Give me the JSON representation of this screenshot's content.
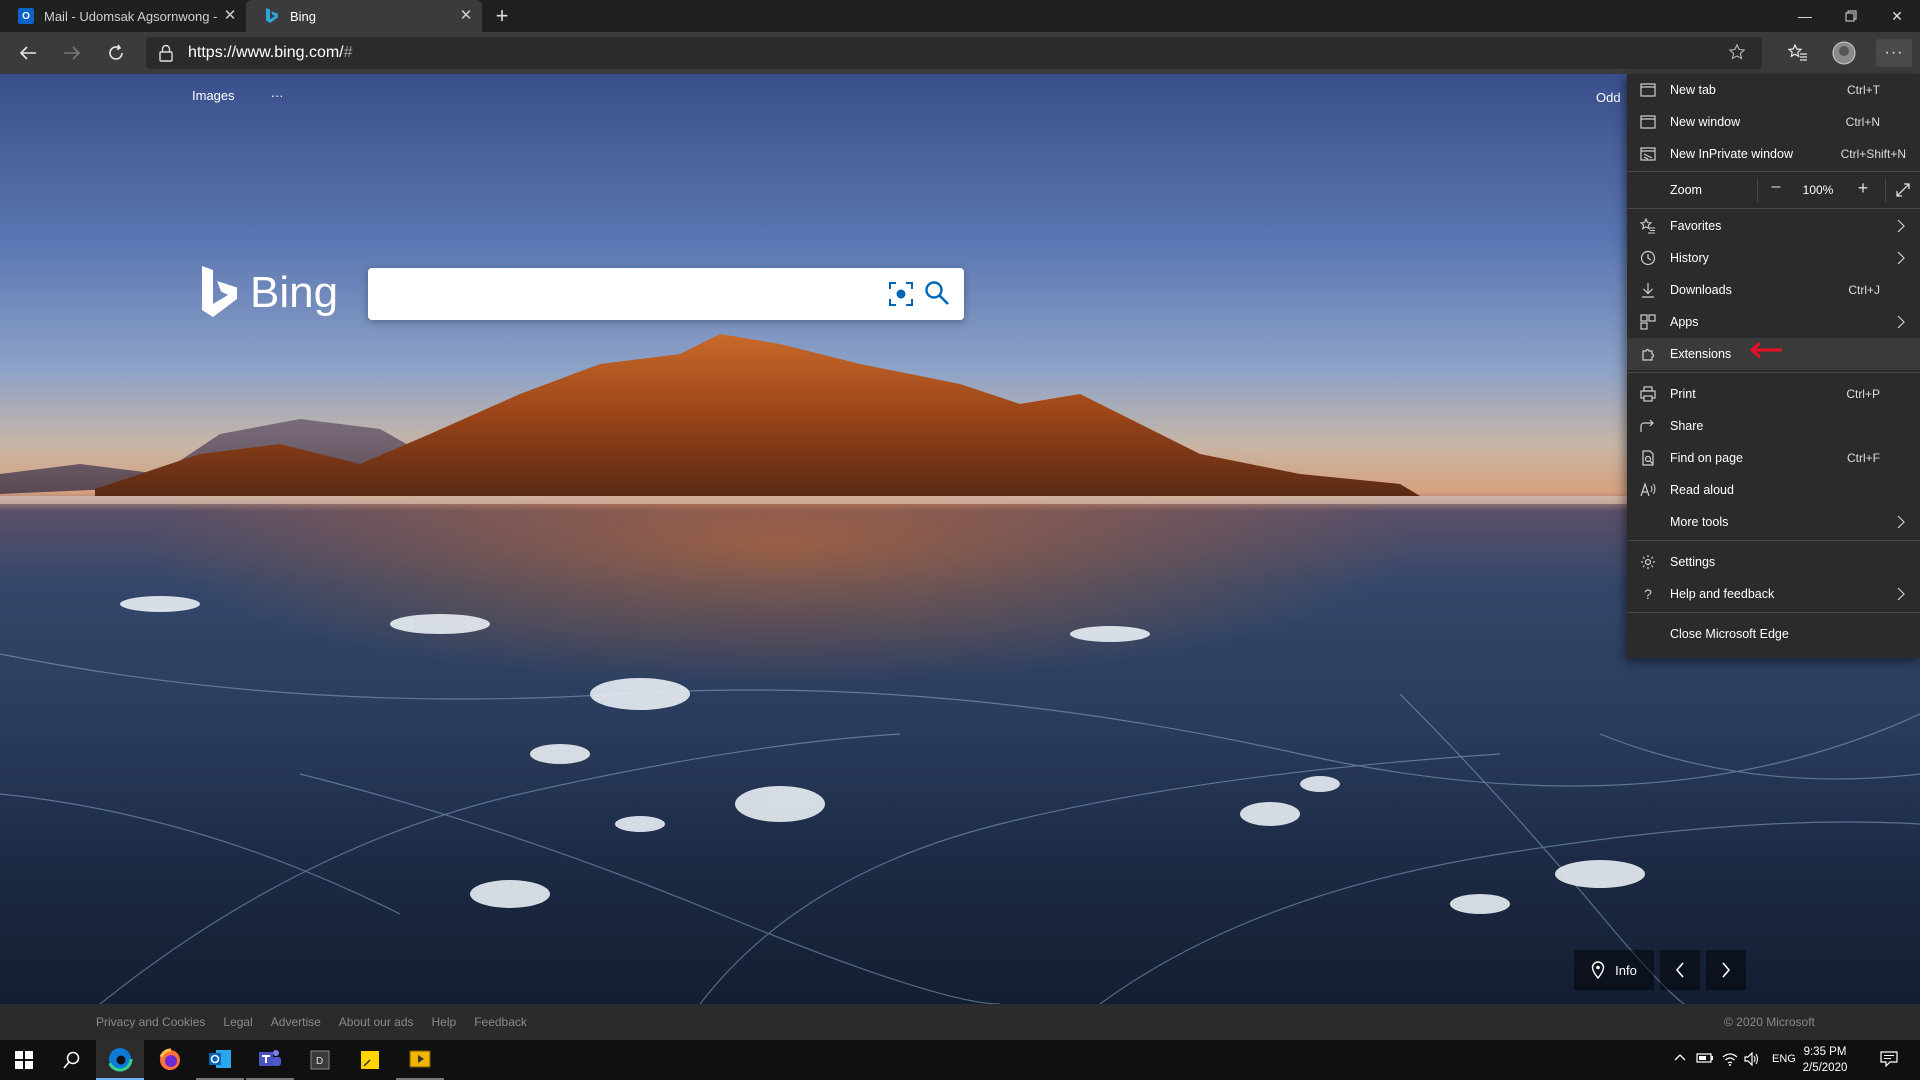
{
  "tabs": [
    {
      "title": "Mail - Udomsak Agsornwong - C",
      "icon": "outlook-icon",
      "active": false
    },
    {
      "title": "Bing",
      "icon": "bing-icon",
      "active": true
    }
  ],
  "toolbar": {
    "url_main": "https://www.bing.com/",
    "url_hash": "#"
  },
  "page": {
    "nav": [
      "Images",
      "···"
    ],
    "top_right": "Odd",
    "logo_text": "Bing",
    "search_placeholder": "",
    "info_label": "Info"
  },
  "footer": {
    "links": [
      "Privacy and Cookies",
      "Legal",
      "Advertise",
      "About our ads",
      "Help",
      "Feedback"
    ],
    "copyright": "© 2020 Microsoft"
  },
  "menu": {
    "new_tab": {
      "label": "New tab",
      "shortcut": "Ctrl+T"
    },
    "new_window": {
      "label": "New window",
      "shortcut": "Ctrl+N"
    },
    "new_inprivate": {
      "label": "New InPrivate window",
      "shortcut": "Ctrl+Shift+N"
    },
    "zoom": {
      "label": "Zoom",
      "value": "100%"
    },
    "favorites": {
      "label": "Favorites"
    },
    "history": {
      "label": "History"
    },
    "downloads": {
      "label": "Downloads",
      "shortcut": "Ctrl+J"
    },
    "apps": {
      "label": "Apps"
    },
    "extensions": {
      "label": "Extensions"
    },
    "print": {
      "label": "Print",
      "shortcut": "Ctrl+P"
    },
    "share": {
      "label": "Share"
    },
    "find": {
      "label": "Find on page",
      "shortcut": "Ctrl+F"
    },
    "read_aloud": {
      "label": "Read aloud"
    },
    "more_tools": {
      "label": "More tools"
    },
    "settings": {
      "label": "Settings"
    },
    "help": {
      "label": "Help and feedback"
    },
    "close": {
      "label": "Close Microsoft Edge"
    }
  },
  "taskbar": {
    "apps": [
      "windows-start-icon",
      "search-icon",
      "edge-icon",
      "firefox-icon",
      "outlook-icon",
      "teams-icon",
      "dev-app-icon",
      "sticky-notes-icon",
      "media-app-icon"
    ],
    "language": "ENG",
    "time": "9:35 PM",
    "date": "2/5/2020"
  },
  "colors": {
    "menu_bg": "#2b2b2b",
    "toolbar_bg": "#3b3b3b",
    "accent_blue": "#0078d4",
    "annotation_red": "#e81123"
  }
}
